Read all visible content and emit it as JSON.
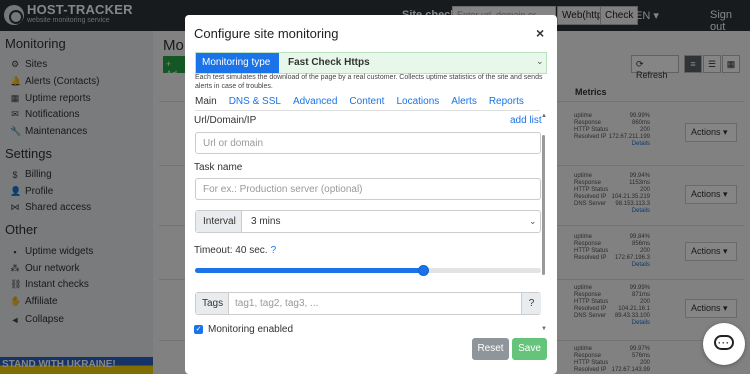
{
  "topbar": {
    "logo_title": "HOST-TRACKER",
    "logo_subtitle": "website monitoring service",
    "site_check_label": "Site check",
    "site_check_placeholder": "Enter url, domain or...",
    "web_button": "Web(http)",
    "check_button": "Check",
    "language": "EN ▾",
    "sign_out": "Sign out"
  },
  "sidebar": {
    "monitoring_heading": "Monitoring",
    "monitoring_items": [
      {
        "label": "Sites",
        "icon": "gear-icon"
      },
      {
        "label": "Alerts (Contacts)",
        "icon": "bell-icon"
      },
      {
        "label": "Uptime reports",
        "icon": "chart-icon"
      },
      {
        "label": "Notifications",
        "icon": "envelope-icon"
      },
      {
        "label": "Maintenances",
        "icon": "wrench-icon"
      }
    ],
    "settings_heading": "Settings",
    "settings_items": [
      {
        "label": "Billing",
        "icon": "dollar-icon"
      },
      {
        "label": "Profile",
        "icon": "user-icon"
      },
      {
        "label": "Shared access",
        "icon": "share-icon"
      }
    ],
    "other_heading": "Other",
    "other_items": [
      {
        "label": "Uptime widgets",
        "icon": "widget-icon"
      },
      {
        "label": "Our network",
        "icon": "network-icon"
      },
      {
        "label": "Instant checks",
        "icon": "link-icon"
      },
      {
        "label": "Affiliate",
        "icon": "handshake-icon"
      },
      {
        "label": "Collapse",
        "icon": "arrow-left-icon"
      }
    ],
    "banner": "STAND WITH UKRAINE!"
  },
  "page": {
    "title": "Mo",
    "add_label": "+ Ad",
    "refresh_label": "⟳ Refresh",
    "metrics_header": "Metrics",
    "actions_label": "Actions ▾",
    "metric_blocks": [
      {
        "rows": [
          [
            "uptime",
            "99.99%"
          ],
          [
            "Response",
            "860ms"
          ],
          [
            "HTTP Status",
            "200"
          ],
          [
            "Resolved IP",
            "172.67.211.199"
          ]
        ],
        "details": "Details"
      },
      {
        "rows": [
          [
            "uptime",
            "99.94%"
          ],
          [
            "Response",
            "1153ms"
          ],
          [
            "HTTP Status",
            "200"
          ],
          [
            "Resolved IP",
            "104.21.35.219"
          ],
          [
            "DNS Server",
            "98.153.113.3"
          ]
        ],
        "details": "Details"
      },
      {
        "rows": [
          [
            "uptime",
            "99.84%"
          ],
          [
            "Response",
            "856ms"
          ],
          [
            "HTTP Status",
            "200"
          ],
          [
            "Resolved IP",
            "172.67.196.3"
          ]
        ],
        "details": "Details"
      },
      {
        "rows": [
          [
            "uptime",
            "99.99%"
          ],
          [
            "Response",
            "871ms"
          ],
          [
            "HTTP Status",
            "200"
          ],
          [
            "Resolved IP",
            "104.21.16.1"
          ],
          [
            "DNS Server",
            "89.43.33.100"
          ]
        ],
        "details": "Details"
      },
      {
        "rows": [
          [
            "uptime",
            "99.97%"
          ],
          [
            "Response",
            "576ms"
          ],
          [
            "HTTP Status",
            "200"
          ],
          [
            "Resolved IP",
            "172.67.143.99"
          ]
        ],
        "details": ""
      }
    ]
  },
  "modal": {
    "title": "Configure site monitoring",
    "close_glyph": "×",
    "monitoring_type_label": "Monitoring type",
    "monitoring_type_value": "Fast Check Https",
    "description": "Each test simulates the download of the page by a real customer. Collects uptime statistics of the site and sends alerts in case of troubles.",
    "tabs": [
      {
        "label": "Main",
        "active": true
      },
      {
        "label": "DNS & SSL",
        "active": false
      },
      {
        "label": "Advanced",
        "active": false
      },
      {
        "label": "Content",
        "active": false
      },
      {
        "label": "Locations",
        "active": false
      },
      {
        "label": "Alerts",
        "active": false
      },
      {
        "label": "Reports",
        "active": false
      }
    ],
    "url_label": "Url/Domain/IP",
    "add_list_link": "add list",
    "url_placeholder": "Url or domain",
    "task_label": "Task name",
    "task_placeholder": "For ex.: Production server (optional)",
    "interval_label": "Interval",
    "interval_value": "3 mins",
    "timeout_label": "Timeout: 40 sec.",
    "timeout_help": "?",
    "timeout_slider_fraction": 0.66,
    "tags_label": "Tags",
    "tags_placeholder": "tag1, tag2, tag3, ...",
    "tags_help": "?",
    "monitoring_enabled_label": "Monitoring enabled",
    "monitoring_enabled_checked": true,
    "reset_label": "Reset",
    "save_label": "Save"
  },
  "colors": {
    "accent_blue": "#1a73e8",
    "save_green": "#65c47a",
    "monitoring_type_bg": "#e7f7e9",
    "topbar": "#2f3439"
  }
}
